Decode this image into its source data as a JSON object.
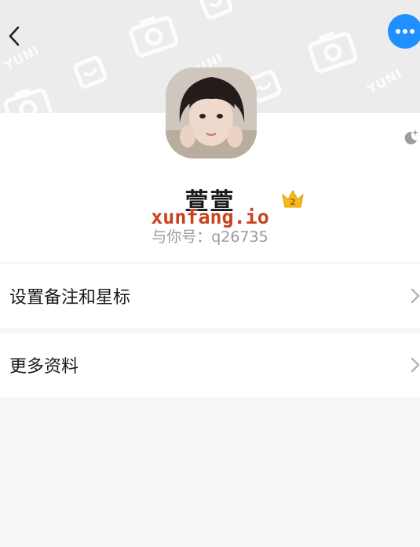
{
  "header": {
    "pattern_text": "YUNI",
    "pattern_icons": [
      "camera-icon",
      "smile-box-icon"
    ]
  },
  "nav": {
    "back_icon": "chevron-left-icon",
    "more_icon": "more-dots-icon",
    "more_color": "#1e90ff"
  },
  "profile": {
    "nickname": "萱萱",
    "level_badge": "2",
    "watermark": "xunfang.io",
    "account_label": "与你号：q26735",
    "night_mode_icon": "moon-star-icon"
  },
  "menu": [
    {
      "label": "设置备注和星标"
    },
    {
      "label": "更多资料"
    }
  ]
}
